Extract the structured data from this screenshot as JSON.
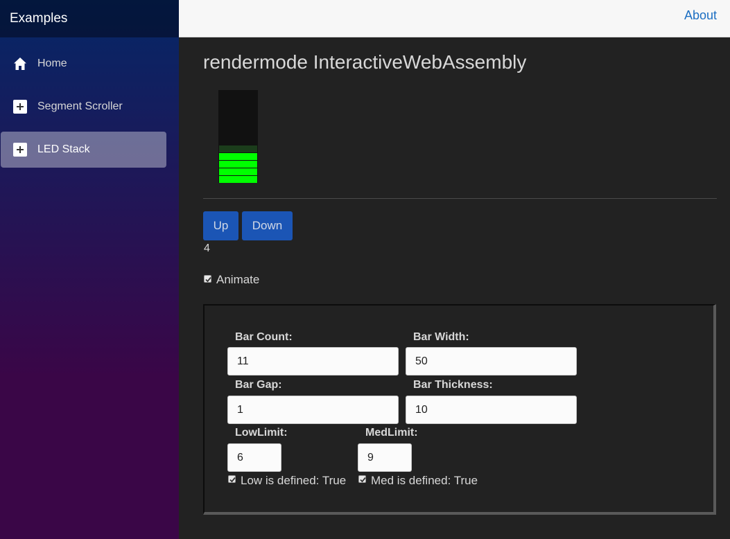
{
  "sidebar": {
    "brand": "Examples",
    "items": [
      {
        "label": "Home",
        "icon": "home-icon",
        "active": false
      },
      {
        "label": "Segment Scroller",
        "icon": "plus-icon",
        "active": false
      },
      {
        "label": "LED Stack",
        "icon": "plus-icon",
        "active": true
      }
    ]
  },
  "topbar": {
    "about_label": "About"
  },
  "main": {
    "title": "rendermode InteractiveWebAssembly",
    "led": {
      "count": 11,
      "lit": 4,
      "on_color": "#00ff00",
      "off_color": "#1b3d1b"
    },
    "buttons": {
      "up": "Up",
      "down": "Down"
    },
    "value": "4",
    "animate_label": "Animate",
    "animate_checked": true
  },
  "settings": {
    "bar_count_label": "Bar Count:",
    "bar_count_value": "11",
    "bar_width_label": "Bar Width:",
    "bar_width_value": "50",
    "bar_gap_label": "Bar Gap:",
    "bar_gap_value": "1",
    "bar_thickness_label": "Bar Thickness:",
    "bar_thickness_value": "10",
    "low_limit_label": "LowLimit:",
    "low_limit_value": "6",
    "med_limit_label": "MedLimit:",
    "med_limit_value": "9",
    "low_defined_label": "Low is defined: True",
    "med_defined_label": "Med is defined: True"
  },
  "colors": {
    "accent": "#1b55b5",
    "link": "#1b6ec2",
    "background": "#222222"
  }
}
